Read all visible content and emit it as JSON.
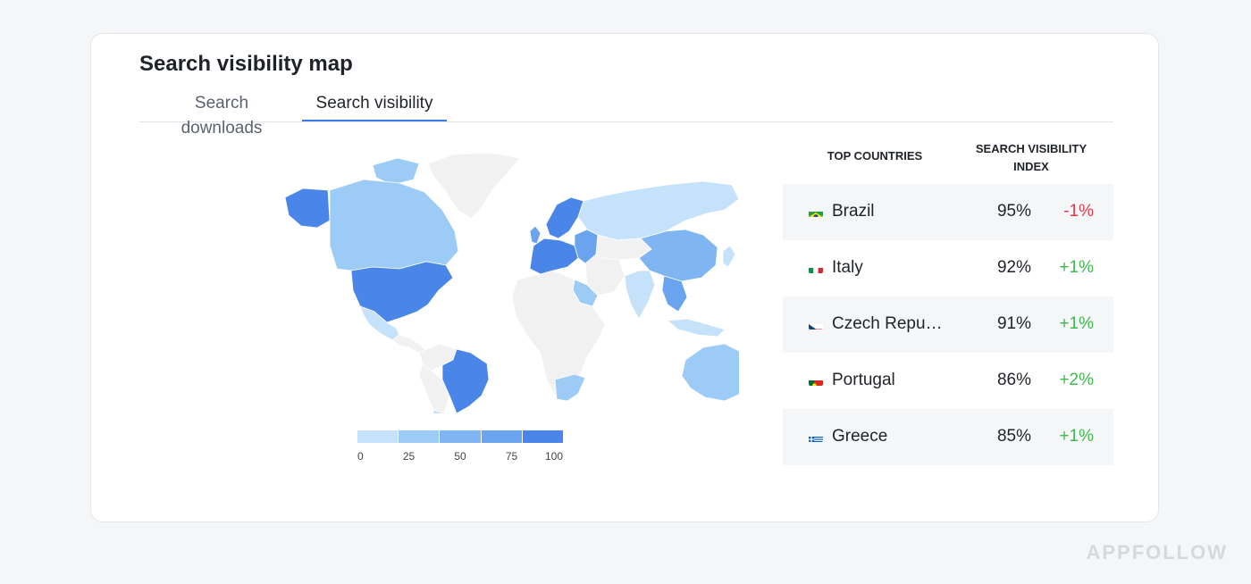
{
  "card": {
    "title": "Search visibility map",
    "tabs": [
      {
        "label": "Search downloads",
        "active": false
      },
      {
        "label": "Search visibility",
        "active": true
      }
    ]
  },
  "map": {
    "legend": {
      "ticks": [
        "0",
        "25",
        "50",
        "75",
        "100"
      ],
      "colors": [
        "#c6e2fb",
        "#9ccbf6",
        "#7fb5f0",
        "#6aa3ee",
        "#4a85e8"
      ]
    },
    "colors": {
      "none": "#f1f1f1",
      "low": "#c6e2fb",
      "mid_low": "#9ccbf6",
      "mid": "#7fb5f0",
      "high": "#6aa3ee",
      "top": "#4a85e8"
    }
  },
  "table": {
    "headers": {
      "country": "TOP COUNTRIES",
      "index_line1": "SEARCH VISIBILITY",
      "index_line2": "INDEX"
    },
    "rows": [
      {
        "country": "Brazil",
        "value": "95%",
        "change": "-1%",
        "trend": "neg",
        "flag": "brazil-flag-icon"
      },
      {
        "country": "Italy",
        "value": "92%",
        "change": "+1%",
        "trend": "pos",
        "flag": "italy-flag-icon"
      },
      {
        "country": "Czech Republic",
        "value": "91%",
        "change": "+1%",
        "trend": "pos",
        "flag": "czech-flag-icon"
      },
      {
        "country": "Portugal",
        "value": "86%",
        "change": "+2%",
        "trend": "pos",
        "flag": "portugal-flag-icon"
      },
      {
        "country": "Greece",
        "value": "85%",
        "change": "+1%",
        "trend": "pos",
        "flag": "greece-flag-icon"
      }
    ],
    "colors": {
      "negative": "#e0394b",
      "positive": "#3fb950"
    }
  },
  "brand": {
    "name": "APPFOLLOW"
  }
}
